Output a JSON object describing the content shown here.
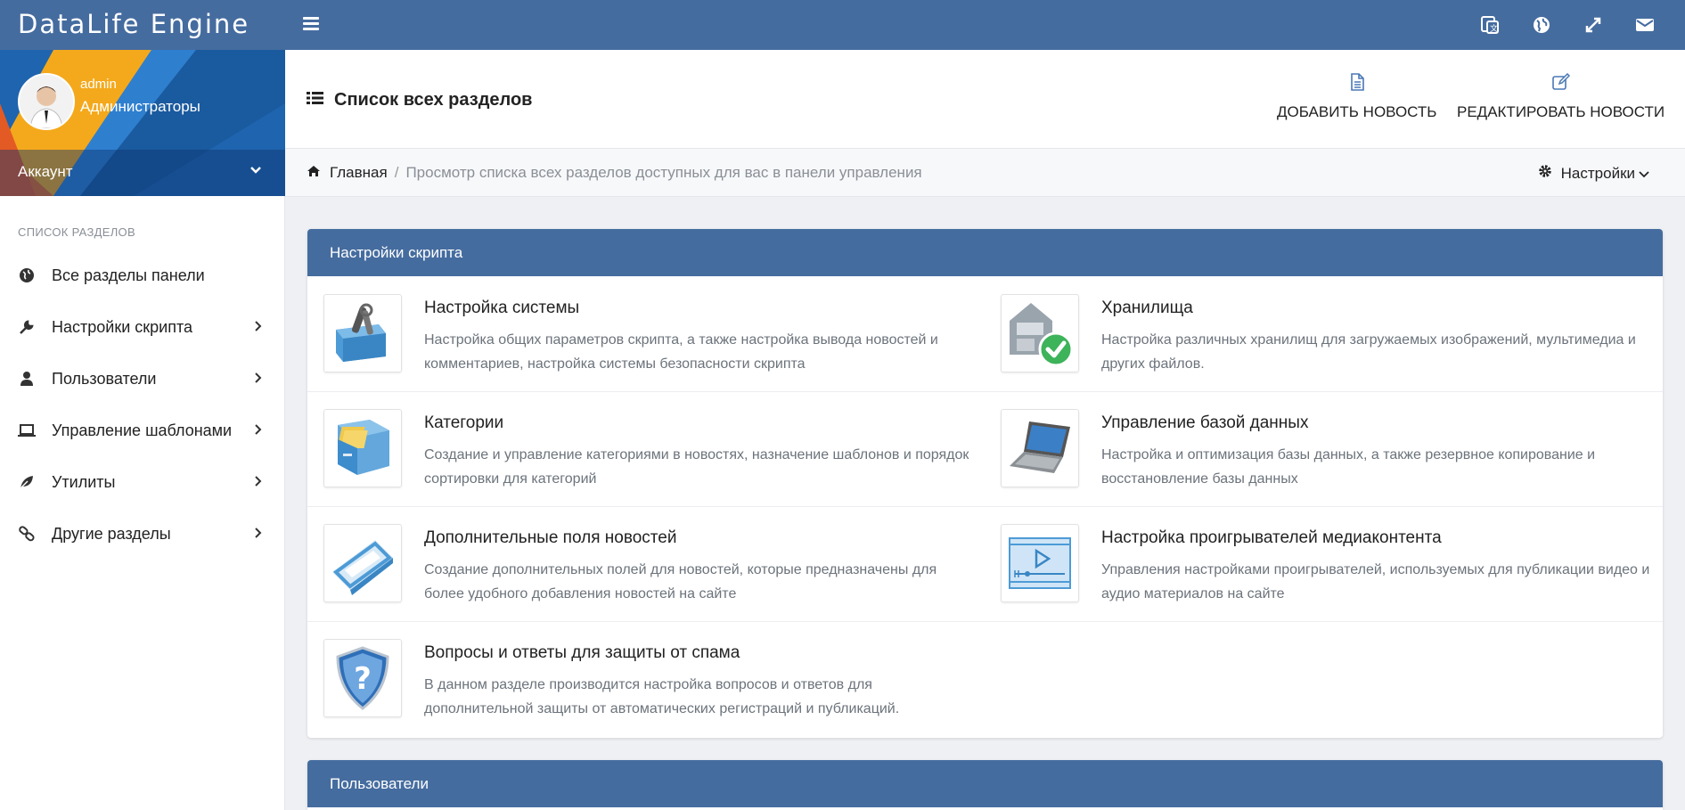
{
  "app": {
    "brand": "DataLife Engine"
  },
  "topbar": {
    "icons": [
      "translate-icon",
      "globe-icon",
      "expand-icon",
      "envelope-icon"
    ]
  },
  "profile": {
    "username": "admin",
    "group": "Администраторы",
    "account_label": "Аккаунт"
  },
  "sidebar": {
    "title": "СПИСОК РАЗДЕЛОВ",
    "items": [
      {
        "label": "Все разделы панели",
        "icon": "globe-icon"
      },
      {
        "label": "Настройки скрипта",
        "icon": "wrench-icon"
      },
      {
        "label": "Пользователи",
        "icon": "user-icon"
      },
      {
        "label": "Управление шаблонами",
        "icon": "laptop-icon"
      },
      {
        "label": "Утилиты",
        "icon": "leaf-icon"
      },
      {
        "label": "Другие разделы",
        "icon": "link-icon"
      }
    ]
  },
  "header": {
    "title": "Список всех разделов",
    "add_news": "ДОБАВИТЬ НОВОСТЬ",
    "edit_news": "РЕДАКТИРОВАТЬ НОВОСТИ"
  },
  "breadcrumb": {
    "home": "Главная",
    "separator": "/",
    "current": "Просмотр списка всех разделов доступных для вас в панели управления",
    "settings": "Настройки"
  },
  "panels": [
    {
      "title": "Настройки скрипта",
      "tiles": [
        {
          "title": "Настройка системы",
          "desc": "Настройка общих параметров скрипта, а также настройка вывода новостей и комментариев, настройка системы безопасности скрипта",
          "icon": "toolbox-icon"
        },
        {
          "title": "Хранилища",
          "desc": "Настройка различных хранилищ для загружаемых изображений, мультимедиа и других файлов.",
          "icon": "storage-check-icon"
        },
        {
          "title": "Категории",
          "desc": "Создание и управление категориями в новостях, назначение шаблонов и порядок сортировки для категорий",
          "icon": "file-drawer-icon"
        },
        {
          "title": "Управление базой данных",
          "desc": "Настройка и оптимизация базы данных, а также резервное копирование и восстановление базы данных",
          "icon": "laptop-icon"
        },
        {
          "title": "Дополнительные поля новостей",
          "desc": "Создание дополнительных полей для новостей, которые предназначены для более удобного добавления новостей на сайте",
          "icon": "ruler-icon"
        },
        {
          "title": "Настройка проигрывателей медиаконтента",
          "desc": "Управления настройками проигрывателей, используемых для публикации видео и аудио материалов на сайте",
          "icon": "media-player-icon"
        },
        {
          "title": "Вопросы и ответы для защиты от спама",
          "desc": "В данном разделе производится настройка вопросов и ответов для дополнительной защиты от автоматических регистраций и публикаций.",
          "icon": "question-shield-icon"
        }
      ]
    },
    {
      "title": "Пользователи",
      "tiles": []
    }
  ],
  "colors": {
    "primary": "#456c9f",
    "panel_header": "#456c9f",
    "background": "#eef0f3",
    "muted_text": "#6c737b"
  }
}
